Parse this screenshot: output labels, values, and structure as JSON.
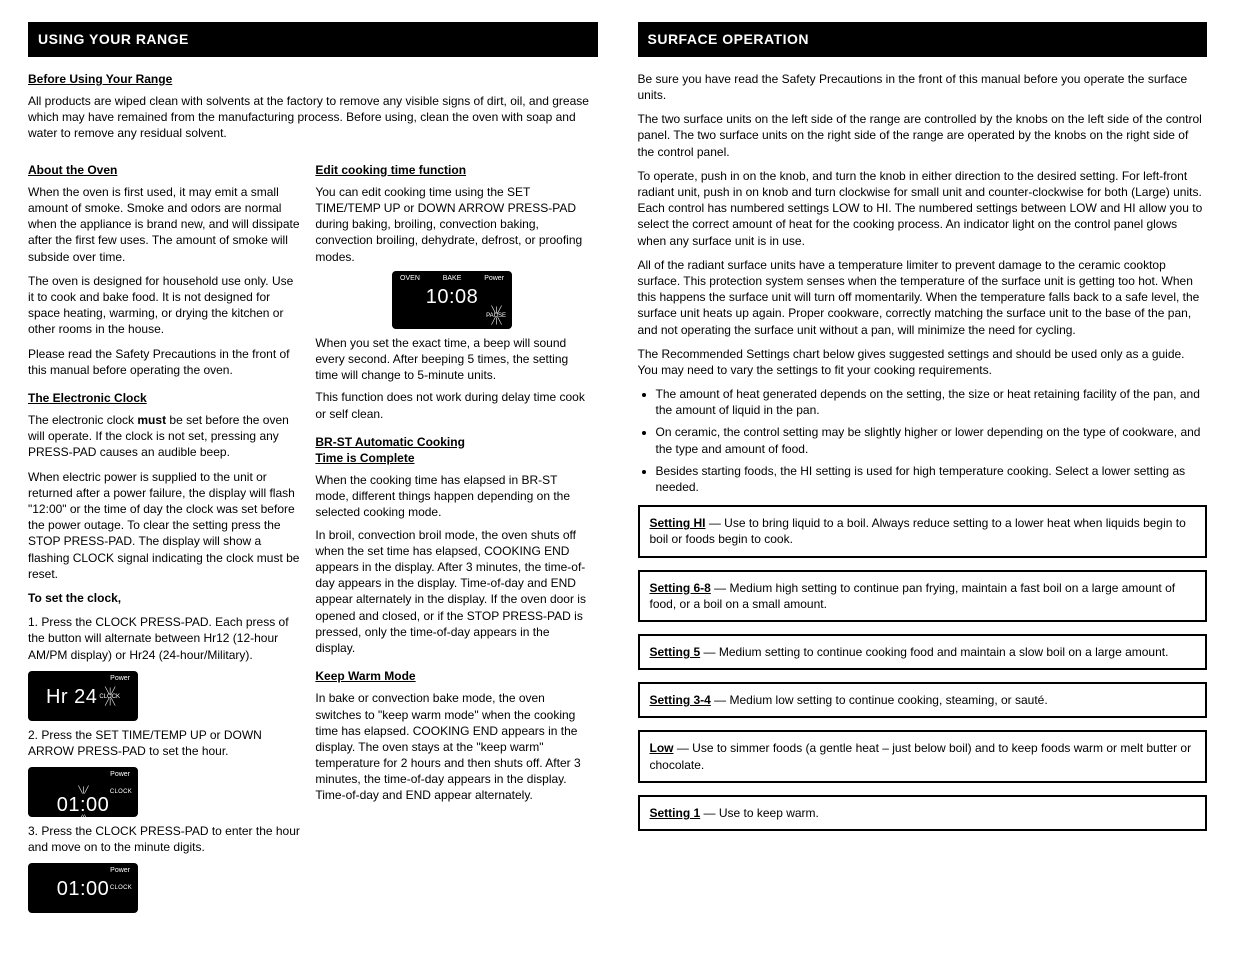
{
  "left": {
    "header": "USING YOUR RANGE",
    "sec1_title": "Before Using Your Range",
    "sec1_p": "All products are wiped clean with solvents at the factory to remove any visible signs of dirt, oil, and grease which may have remained from the manufacturing process. Before using, clean the oven with soap and water to remove any residual solvent.",
    "sec2_title": "About the Oven",
    "sec2_p1": "When the oven is first used, it may emit a small amount of smoke. Smoke and odors are normal when the appliance is brand new, and will dissipate after the first few uses. The amount of smoke will subside over time.",
    "sec2_p2": "The oven is designed for household use only. Use it to cook and bake food. It is not designed for space heating, warming, or drying the kitchen or other rooms in the house.",
    "sec2_p3": "Please read the Safety Precautions in the front of this manual before operating the oven.",
    "clock_title": "The Electronic Clock",
    "clock_p1a": "The electronic clock ",
    "clock_p1b": "must",
    "clock_p1c": " be set before the oven will operate. If the clock is not set, pressing any PRESS-PAD causes an audible beep.",
    "clock_p2": "When electric power is supplied to the unit or returned after a power failure, the display will flash \"12:00\" or the time of day the clock was set before the power outage. To clear the setting press the STOP PRESS-PAD. The display will show a flashing CLOCK signal indicating the clock must be reset.",
    "steps_intro": "To set the clock,",
    "step1": "1. Press the CLOCK PRESS-PAD. Each press of the button will alternate between Hr12 (12-hour AM/PM display) or Hr24 (24-hour/Military).",
    "lcd1": {
      "power": "Power",
      "big": "Hr 24",
      "side": "CLOCK"
    },
    "step2": "2. Press the SET TIME/TEMP UP or DOWN ARROW PRESS-PAD to set the hour.",
    "lcd2": {
      "power": "Power",
      "big": "01:00",
      "side": "CLOCK"
    },
    "step3": "3. Press the CLOCK PRESS-PAD to enter the hour and move on to the minute digits.",
    "lcd3": {
      "power": "Power",
      "big": "01:00",
      "side": "CLOCK"
    },
    "right_sub": {
      "title": "Edit cooking time function",
      "p1": "You can edit cooking time using the SET TIME/TEMP UP or DOWN ARROW PRESS-PAD during baking, broiling, convection baking, convection broiling, dehydrate, defrost, or proofing modes.",
      "lcd": {
        "oven": "OVEN",
        "bake": "BAKE",
        "power": "Power",
        "big": "10:08",
        "pause": "PAUSE"
      },
      "p2": "When you set the exact time, a beep will sound every second. After beeping 5 times, the setting time will change to 5-minute units.",
      "p3": "This function does not work during delay time cook or self clean.",
      "brst_title": "BR-ST Automatic Cooking",
      "brst_sub": "Time is Complete",
      "brst_p1": "When the cooking time has elapsed in BR-ST mode, different things happen depending on the selected cooking mode.",
      "brst_p2": "In broil, convection broil mode, the oven shuts off when the set time has elapsed, COOKING END appears in the display. After 3 minutes, the time-of-day appears in the display. Time-of-day and END appear alternately in the display. If the oven door is opened and closed, or if the STOP PRESS-PAD is pressed, only the time-of-day appears in the display.",
      "keep_title": "Keep Warm Mode",
      "keep_p": "In bake or convection bake mode, the oven switches to \"keep warm mode\" when the cooking time has elapsed. COOKING END appears in the display. The oven stays at the \"keep warm\" temperature for 2 hours and then shuts off. After 3 minutes, the time-of-day appears in the display. Time-of-day and END appear alternately."
    }
  },
  "right": {
    "header": "SURFACE OPERATION",
    "p1": "Be sure you have read the Safety Precautions in the front of this manual before you operate the surface units.",
    "p2": "The two surface units on the left side of the range are controlled by the knobs on the left side of the control panel. The two surface units on the right side of the range are operated by the knobs on the right side of the control panel.",
    "p3": "To operate, push in on the knob, and turn the knob in either direction to the desired setting. For left-front radiant unit, push in on knob and turn clockwise for small unit and counter-clockwise for both (Large) units. Each control has numbered settings LOW to HI. The numbered settings between LOW and HI allow you to select the correct amount of heat for the cooking process. An indicator light on the control panel glows when any surface unit is in use.",
    "p4": "All of the radiant surface units have a temperature limiter to prevent damage to the ceramic cooktop surface. This protection system senses when the temperature of the surface unit is getting too hot. When this happens the surface unit will turn off momentarily. When the temperature falls back to a safe level, the surface unit heats up again. Proper cookware, correctly matching the surface unit to the base of the pan, and not operating the surface unit without a pan, will minimize the need for cycling.",
    "rec_p": "The Recommended Settings chart below gives suggested settings and should be used only as a guide. You may need to vary the settings to fit your cooking requirements.",
    "bullets": [
      "The amount of heat generated depends on the setting, the size or heat retaining facility of the pan, and the amount of liquid in the pan.",
      "On ceramic, the control setting may be slightly higher or lower depending on the type of cookware, and the type and amount of food.",
      "Besides starting foods, the HI setting is used for high temperature cooking. Select a lower setting as needed."
    ],
    "boxes": [
      {
        "title": "Setting HI",
        "body": " — Use to bring liquid to a boil. Always reduce setting to a lower heat when liquids begin to boil or foods begin to cook."
      },
      {
        "title": "Setting 6-8",
        "body": " — Medium high setting to continue pan frying, maintain a fast boil on a large amount of food, or a boil on a small amount."
      },
      {
        "title": "Setting 5",
        "body": " — Medium setting to continue cooking food and maintain a slow boil on a large amount."
      },
      {
        "title": "Setting 3-4",
        "body": " — Medium low setting to continue cooking, steaming, or sauté."
      },
      {
        "title": "Low",
        "body": " — Use to simmer foods (a gentle heat – just below boil) and to keep foods warm or melt butter or chocolate."
      },
      {
        "title": "Setting 1",
        "body": " — Use to keep warm."
      }
    ]
  }
}
